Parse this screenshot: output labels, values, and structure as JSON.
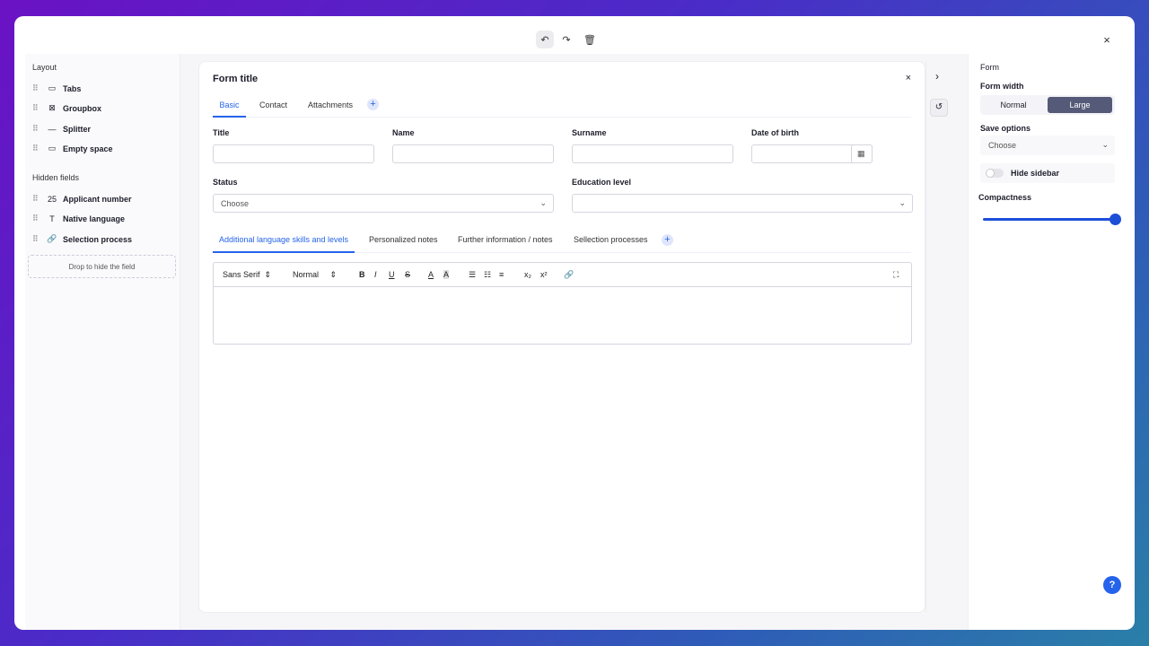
{
  "toolbar": {
    "undo": "undo",
    "redo": "redo",
    "delete": "delete",
    "close": "×"
  },
  "left": {
    "layout_title": "Layout",
    "layout_items": [
      {
        "icon": "▭",
        "label": "Tabs"
      },
      {
        "icon": "⊠",
        "label": "Groupbox"
      },
      {
        "icon": "—",
        "label": "Splitter"
      },
      {
        "icon": "▭",
        "label": "Empty space"
      }
    ],
    "hidden_title": "Hidden fields",
    "hidden_items": [
      {
        "icon": "25",
        "label": "Applicant number"
      },
      {
        "icon": "T",
        "label": "Native language"
      },
      {
        "icon": "🔗",
        "label": "Selection process"
      }
    ],
    "drop_text": "Drop to hide the field"
  },
  "form": {
    "title": "Form title",
    "tabs": [
      "Basic",
      "Contact",
      "Attachments"
    ],
    "fields": {
      "title": "Title",
      "name": "Name",
      "surname": "Surname",
      "dob": "Date of birth",
      "status": "Status",
      "status_placeholder": "Choose",
      "education": "Education level"
    },
    "subtabs": [
      "Additional language skills and levels",
      "Personalized notes",
      "Further information / notes",
      "Sellection processes"
    ],
    "editor": {
      "font": "Sans Serif",
      "size": "Normal"
    }
  },
  "settings": {
    "section": "Form",
    "width_label": "Form width",
    "width_options": [
      "Normal",
      "Large"
    ],
    "width_selected": "Large",
    "save_label": "Save options",
    "save_placeholder": "Choose",
    "hide_sidebar": "Hide sidebar",
    "hide_sidebar_on": false,
    "compactness_label": "Compactness",
    "compactness_value": 1.0
  },
  "help": "?"
}
